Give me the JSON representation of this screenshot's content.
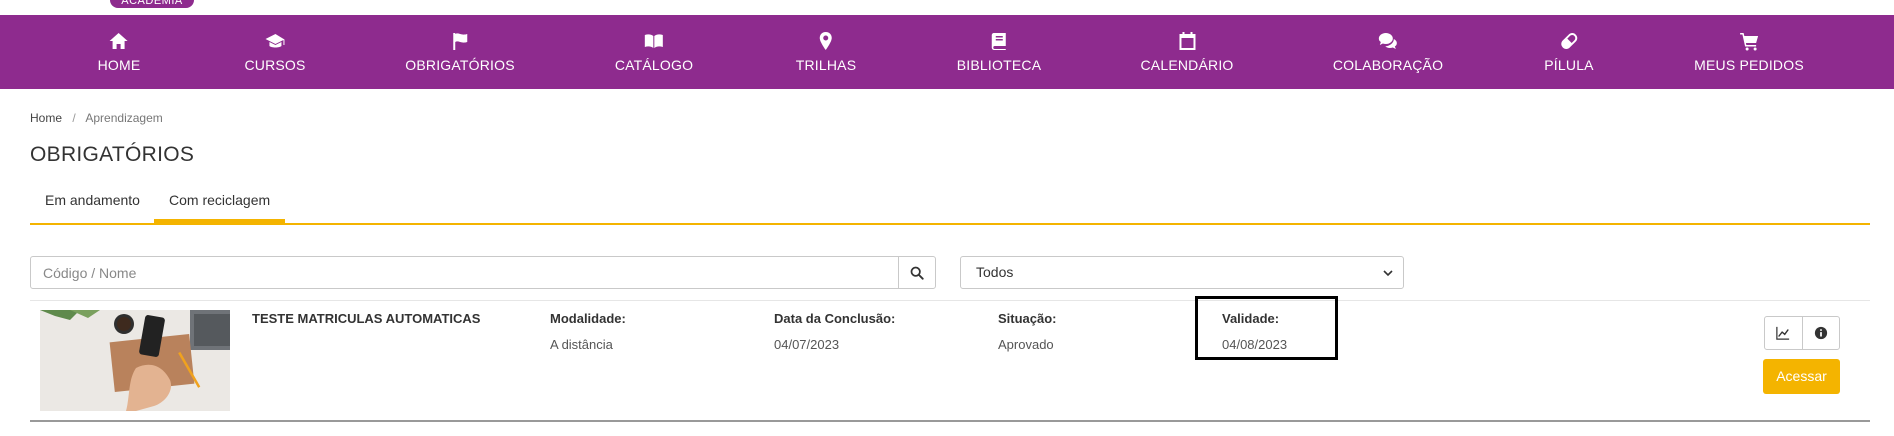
{
  "brand": {
    "label": "ACADEMIA"
  },
  "nav": {
    "items": [
      {
        "label": "HOME",
        "icon": "home-icon"
      },
      {
        "label": "CURSOS",
        "icon": "graduation-cap-icon"
      },
      {
        "label": "OBRIGATÓRIOS",
        "icon": "flag-icon"
      },
      {
        "label": "CATÁLOGO",
        "icon": "open-book-icon"
      },
      {
        "label": "TRILHAS",
        "icon": "map-marker-icon"
      },
      {
        "label": "BIBLIOTECA",
        "icon": "book-icon"
      },
      {
        "label": "CALENDÁRIO",
        "icon": "calendar-icon"
      },
      {
        "label": "COLABORAÇÃO",
        "icon": "comments-icon"
      },
      {
        "label": "PÍLULA",
        "icon": "pill-icon"
      },
      {
        "label": "MEUS PEDIDOS",
        "icon": "shopping-cart-icon"
      }
    ]
  },
  "breadcrumb": {
    "home": "Home",
    "separator": "/",
    "current": "Aprendizagem"
  },
  "page": {
    "title": "OBRIGATÓRIOS"
  },
  "tabs": [
    {
      "label": "Em andamento",
      "active": false
    },
    {
      "label": "Com reciclagem",
      "active": true
    }
  ],
  "search": {
    "placeholder": "Código / Nome",
    "value": ""
  },
  "filter": {
    "selected": "Todos"
  },
  "course": {
    "title": "TESTE MATRICULAS AUTOMATICAS",
    "fields": [
      {
        "key": "Modalidade:",
        "value": "A distância"
      },
      {
        "key": "Data da Conclusão:",
        "value": "04/07/2023"
      },
      {
        "key": "Situação:",
        "value": "Aprovado"
      },
      {
        "key": "Validade:",
        "value": "04/08/2023"
      }
    ],
    "access_label": "Acessar"
  },
  "colors": {
    "primary": "#8e2b8e",
    "accent": "#f4b400",
    "highlight_border": "#000000"
  }
}
